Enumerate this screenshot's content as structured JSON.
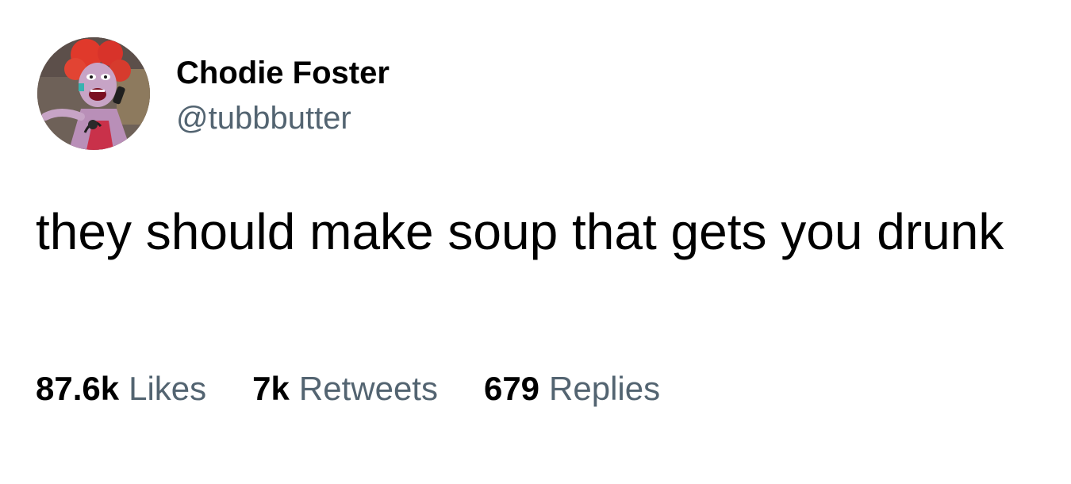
{
  "author": {
    "display_name": "Chodie Foster",
    "handle": "@tubbbutter",
    "avatar_icon": "cartoon-character-on-phone-avatar"
  },
  "tweet": {
    "text": "they should make soup that gets you drunk"
  },
  "stats": [
    {
      "count": "87.6k",
      "label": "Likes"
    },
    {
      "count": "7k",
      "label": "Retweets"
    },
    {
      "count": "679",
      "label": "Replies"
    }
  ],
  "colors": {
    "text_primary": "#000000",
    "text_secondary": "#536471",
    "background": "#ffffff"
  }
}
